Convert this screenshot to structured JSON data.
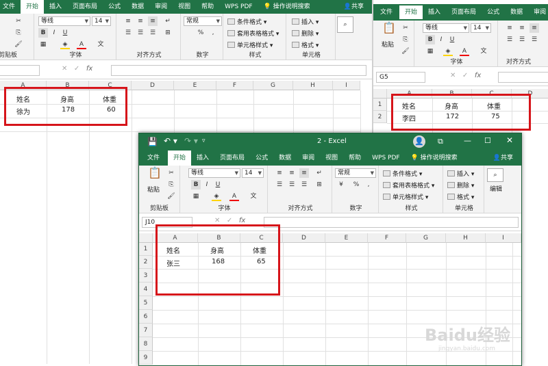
{
  "w1": {
    "tabs": [
      "文件",
      "开始",
      "插入",
      "页面布局",
      "公式",
      "数据",
      "审阅",
      "视图",
      "帮助",
      "WPS PDF",
      "操作说明搜索",
      "共享"
    ],
    "active_tab": "开始",
    "clipboard_label": "剪贴板",
    "font_name": "等线",
    "font_size": "14",
    "font_label": "字体",
    "align_label": "对齐方式",
    "number_format": "常规",
    "number_label": "数字",
    "cond_format": "条件格式",
    "table_format": "套用表格格式",
    "cell_style": "单元格样式",
    "styles_label": "样式",
    "insert": "插入",
    "delete": "删除",
    "format": "格式",
    "cells_label": "单元格",
    "name_box": "",
    "fx": "fx",
    "cols": [
      "A",
      "B",
      "C",
      "D",
      "E",
      "F",
      "G",
      "H",
      "I"
    ],
    "rows": [
      [
        "姓名",
        "身高",
        "体重"
      ],
      [
        "徐为",
        "178",
        "60"
      ]
    ]
  },
  "w2": {
    "tabs": [
      "文件",
      "开始",
      "插入",
      "页面布局",
      "公式",
      "数据",
      "审阅"
    ],
    "active_tab": "开始",
    "clipboard": "粘贴",
    "font_name": "等线",
    "font_size": "14",
    "font_label": "字体",
    "align_label": "对齐方式",
    "name_box": "G5",
    "fx": "fx",
    "cols": [
      "A",
      "B",
      "C",
      "D"
    ],
    "row_nums": [
      "1",
      "2"
    ],
    "rows": [
      [
        "姓名",
        "身高",
        "体重"
      ],
      [
        "李四",
        "172",
        "75"
      ]
    ]
  },
  "w3": {
    "title": "2 - Excel",
    "tabs": [
      "文件",
      "开始",
      "插入",
      "页面布局",
      "公式",
      "数据",
      "审阅",
      "视图",
      "帮助",
      "WPS PDF",
      "操作说明搜索",
      "共享"
    ],
    "active_tab": "开始",
    "paste": "粘贴",
    "clipboard_label": "剪贴板",
    "font_name": "等线",
    "font_size": "14",
    "font_label": "字体",
    "align_label": "对齐方式",
    "number_format": "常规",
    "number_label": "数字",
    "cond_format": "条件格式",
    "table_format": "套用表格格式",
    "cell_style": "单元格样式",
    "styles_label": "样式",
    "insert": "插入",
    "delete": "删除",
    "format": "格式",
    "cells_label": "单元格",
    "edit": "编辑",
    "name_box": "J10",
    "fx": "fx",
    "cols": [
      "A",
      "B",
      "C",
      "D",
      "E",
      "F",
      "G",
      "H",
      "I"
    ],
    "row_nums": [
      "1",
      "2",
      "3",
      "4",
      "5",
      "6",
      "7",
      "8",
      "9"
    ],
    "rows": [
      [
        "姓名",
        "身高",
        "体重"
      ],
      [
        "张三",
        "168",
        "65"
      ]
    ]
  },
  "watermark": {
    "brand": "Baidu经验",
    "url": "jingyan.baidu.com"
  },
  "colors": {
    "excel_green": "#217346",
    "highlight_red": "#d6141a"
  },
  "icons": [
    "cut-icon",
    "copy-icon",
    "format-painter-icon",
    "bold-icon",
    "italic-icon",
    "underline-icon",
    "fill-color-icon",
    "font-color-icon",
    "search-icon",
    "save-icon",
    "undo-icon",
    "redo-icon",
    "user-icon",
    "restore-icon",
    "minimize-icon",
    "maximize-icon",
    "close-icon",
    "lightbulb-icon"
  ]
}
